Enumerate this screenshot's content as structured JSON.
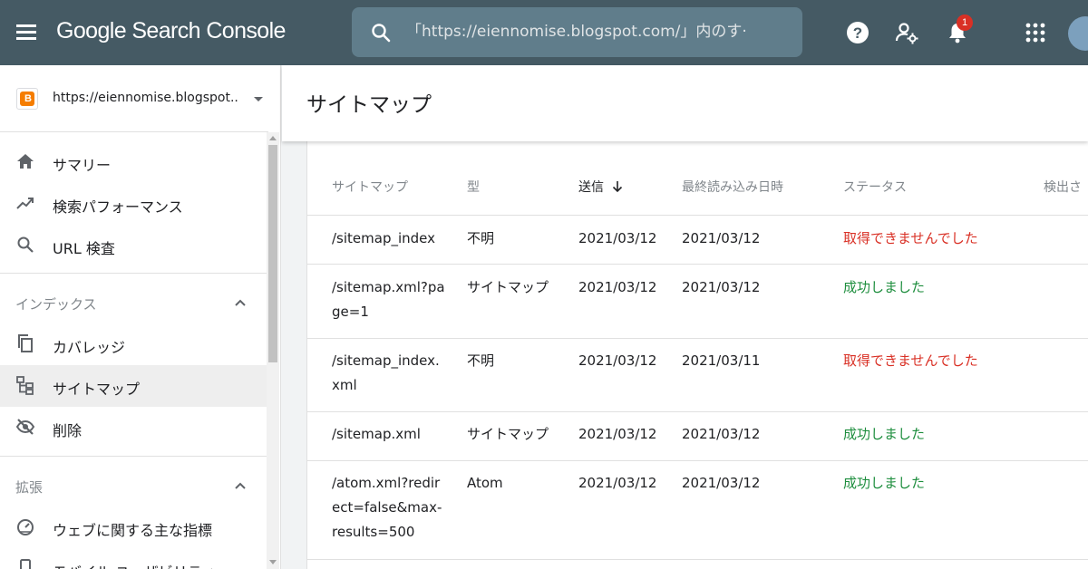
{
  "app": {
    "title": "Google Search Console",
    "search_placeholder": "「https://eiennomise.blogspot.com/」内のす·",
    "notification_count": "1",
    "icons": [
      "menu-icon",
      "search-icon",
      "help-icon",
      "users-settings-icon",
      "bell-icon",
      "apps-grid-icon"
    ]
  },
  "sidebar": {
    "property": "https://eiennomise.blogspot....",
    "items": [
      {
        "label": "サマリー",
        "icon": "home-icon"
      },
      {
        "label": "検索パフォーマンス",
        "icon": "trending-up-icon"
      },
      {
        "label": "URL 検査",
        "icon": "search-icon"
      }
    ],
    "index_section": "インデックス",
    "index_items": [
      {
        "label": "カバレッジ",
        "icon": "copy-icon"
      },
      {
        "label": "サイトマップ",
        "icon": "sitemap-icon",
        "active": true
      },
      {
        "label": "削除",
        "icon": "visibility-off-icon"
      }
    ],
    "extensions_section": "拡張",
    "extension_items": [
      {
        "label": "ウェブに関する主な指標",
        "icon": "gauge-icon"
      },
      {
        "label": "モバイル ユーザビリティ",
        "icon": "phone-icon"
      }
    ]
  },
  "main": {
    "title": "サイトマップ",
    "table": {
      "headers": [
        "サイトマップ",
        "型",
        "送信",
        "最終読み込み日時",
        "ステータス",
        "検出さ"
      ],
      "sorted_column": "送信",
      "rows": [
        {
          "sitemap": "/sitemap_index",
          "type": "不明",
          "submitted": "2021/03/12",
          "last_read": "2021/03/12",
          "status": "取得できませんでした",
          "ok": false
        },
        {
          "sitemap": "/sitemap.xml?page=1",
          "type": "サイトマップ",
          "submitted": "2021/03/12",
          "last_read": "2021/03/12",
          "status": "成功しました",
          "ok": true
        },
        {
          "sitemap": "/sitemap_index.xml",
          "type": "不明",
          "submitted": "2021/03/12",
          "last_read": "2021/03/11",
          "status": "取得できませんでした",
          "ok": false
        },
        {
          "sitemap": "/sitemap.xml",
          "type": "サイトマップ",
          "submitted": "2021/03/12",
          "last_read": "2021/03/12",
          "status": "成功しました",
          "ok": true
        },
        {
          "sitemap": "/atom.xml?redirect=false&max-results=500",
          "type": "Atom",
          "submitted": "2021/03/12",
          "last_read": "2021/03/12",
          "status": "成功しました",
          "ok": true
        }
      ]
    }
  },
  "colors": {
    "topbar": "#455a64",
    "search_bg": "#607d8b",
    "status_fail": "#d93025",
    "status_ok": "#1e8e3e",
    "blogger_orange": "#f57d00"
  }
}
